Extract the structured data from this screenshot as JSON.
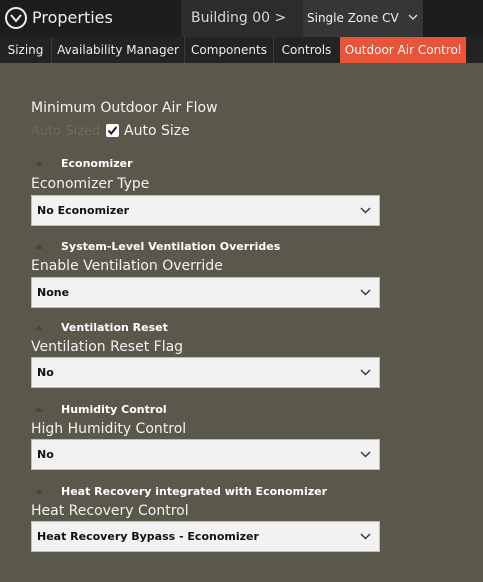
{
  "header": {
    "title": "Properties",
    "building_label": "Building 00 >",
    "zone_label": "Single Zone  CV"
  },
  "tabs": [
    {
      "label": "Sizing"
    },
    {
      "label": "Availability Manager"
    },
    {
      "label": "Components"
    },
    {
      "label": "Controls"
    },
    {
      "label": "Outdoor Air Control",
      "active": true
    }
  ],
  "min_oa": {
    "title": "Minimum Outdoor Air Flow",
    "auto_sized_text": "Auto Sized",
    "auto_size_label": "Auto Size",
    "auto_size_checked": true
  },
  "groups": [
    {
      "heading": "Economizer",
      "field_label": "Economizer Type",
      "value": "No Economizer"
    },
    {
      "heading": "System-Level Ventilation Overrides",
      "field_label": "Enable Ventilation Override",
      "value": "None"
    },
    {
      "heading": "Ventilation Reset",
      "field_label": "Ventilation Reset Flag",
      "value": "No"
    },
    {
      "heading": "Humidity Control",
      "field_label": "High Humidity Control",
      "value": "No"
    },
    {
      "heading": "Heat Recovery integrated with Economizer",
      "field_label": "Heat Recovery Control",
      "value": "Heat Recovery Bypass - Economizer"
    }
  ],
  "colors": {
    "panel_bg": "#5a574b",
    "header_bg": "#1d1d1d",
    "active_tab": "#e8543a",
    "dropdown_bg": "#f2f2f2"
  },
  "icons": {
    "properties": "chevron-circle-down-icon",
    "dropdown": "chevron-down-icon",
    "collapse": "triangle-up-icon",
    "checkbox": "checkmark-icon"
  }
}
